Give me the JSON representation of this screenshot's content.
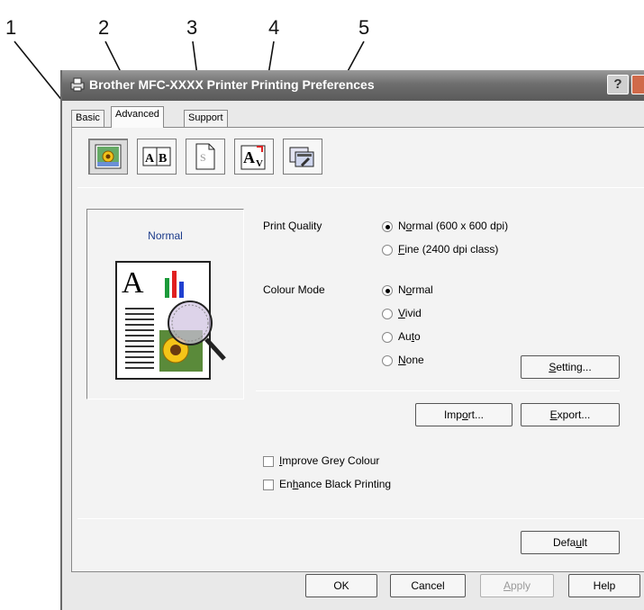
{
  "callouts": [
    "1",
    "2",
    "3",
    "4",
    "5"
  ],
  "window": {
    "title": "Brother MFC-XXXX Printer Printing Preferences",
    "help_glyph": "?"
  },
  "tabs": [
    {
      "label": "Basic",
      "active": false
    },
    {
      "label": "Advanced",
      "active": true
    },
    {
      "label": "Support",
      "active": false
    }
  ],
  "toolbar": {
    "icons": [
      "colour-print-quality-icon",
      "duplex-icon",
      "watermark-icon",
      "page-setting-icon",
      "device-options-icon"
    ]
  },
  "preview": {
    "label": "Normal"
  },
  "print_quality": {
    "label": "Print Quality",
    "options": [
      {
        "pre": "N",
        "ul": "o",
        "post": "rmal (600 x 600 dpi)",
        "selected": true
      },
      {
        "pre": "",
        "ul": "F",
        "post": "ine (2400 dpi class)",
        "selected": false
      }
    ]
  },
  "colour_mode": {
    "label": "Colour Mode",
    "options": [
      {
        "pre": "N",
        "ul": "o",
        "post": "rmal",
        "selected": true
      },
      {
        "pre": "",
        "ul": "V",
        "post": "ivid",
        "selected": false
      },
      {
        "pre": "Au",
        "ul": "t",
        "post": "o",
        "selected": false
      },
      {
        "pre": "",
        "ul": "N",
        "post": "one",
        "selected": false
      }
    ]
  },
  "buttons": {
    "setting": {
      "pre": "",
      "ul": "S",
      "post": "etting..."
    },
    "import": {
      "pre": "Imp",
      "ul": "o",
      "post": "rt..."
    },
    "export": {
      "pre": "",
      "ul": "E",
      "post": "xport..."
    },
    "default": {
      "pre": "Defa",
      "ul": "u",
      "post": "lt"
    },
    "ok": "OK",
    "cancel": "Cancel",
    "apply": {
      "pre": "",
      "ul": "A",
      "post": "pply"
    },
    "help": "Help"
  },
  "checkboxes": [
    {
      "pre": "",
      "ul": "I",
      "post": "mprove Grey Colour",
      "checked": false
    },
    {
      "pre": "En",
      "ul": "h",
      "post": "ance Black Printing",
      "checked": false
    }
  ]
}
